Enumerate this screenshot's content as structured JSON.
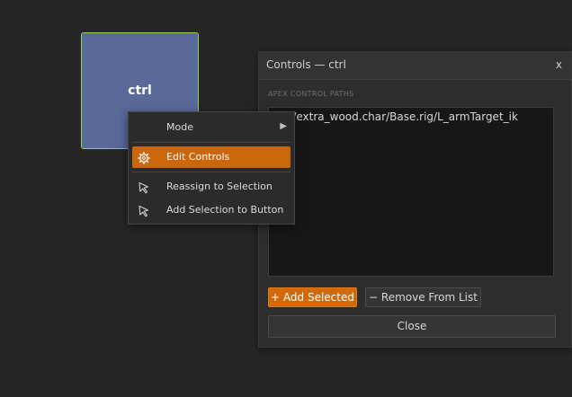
{
  "picker": {
    "button_label": "ctrl"
  },
  "context_menu": {
    "items": [
      {
        "label": "Mode",
        "icon": "",
        "has_submenu": true
      },
      {
        "label": "Edit Controls",
        "icon": "gear-icon",
        "active": true
      },
      {
        "label": "Reassign to Selection",
        "icon": "cursor-icon"
      },
      {
        "label": "Add Selection to Button",
        "icon": "cursor-icon"
      }
    ],
    "submenu_arrow": "▶"
  },
  "dialog": {
    "title": "Controls — ctrl",
    "close_x": "x",
    "section_label": "APEX CONTROL PATHS",
    "paths": [
      "/obj/extra_wood.char/Base.rig/L_armTarget_ik"
    ],
    "add_selected_label": "+ Add Selected",
    "remove_label": "− Remove From List",
    "close_label": "Close"
  },
  "colors": {
    "accent": "#d16a0c",
    "picker_fill": "#59699a",
    "picker_border": "#8fd14b",
    "background": "#262626"
  }
}
